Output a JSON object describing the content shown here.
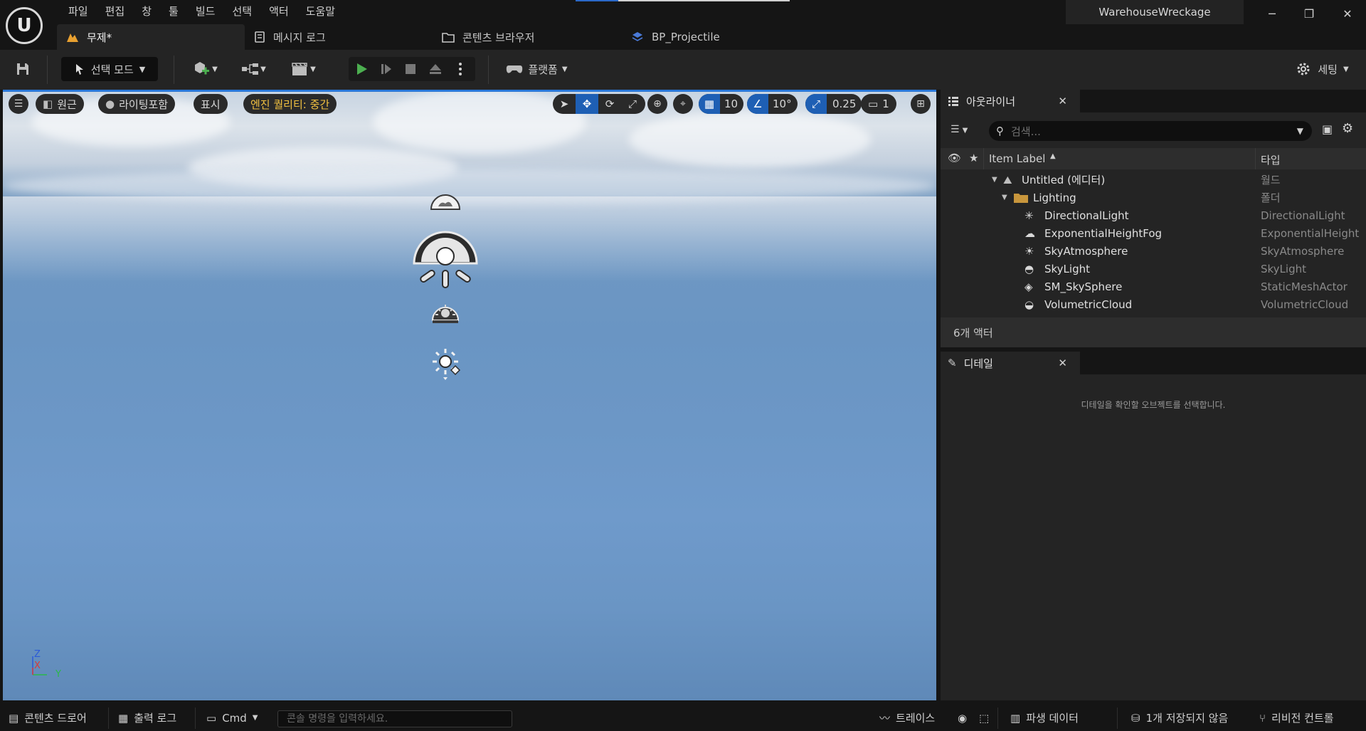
{
  "menu": [
    "파일",
    "편집",
    "창",
    "툴",
    "빌드",
    "선택",
    "액터",
    "도움말"
  ],
  "project_name": "WarehouseWreckage",
  "tabs": [
    {
      "label": "무제*",
      "active": true
    },
    {
      "label": "메시지 로그",
      "active": false
    },
    {
      "label": "콘텐츠 브라우저",
      "active": false
    },
    {
      "label": "BP_Projectile",
      "active": false
    }
  ],
  "toolbar": {
    "mode_label": "선택 모드",
    "platform_label": "플랫폼",
    "settings_label": "세팅"
  },
  "viewport": {
    "perspective_label": "원근",
    "lighting_label": "라이팅포함",
    "show_label": "표시",
    "quality_label": "엔진 퀄리티: 중간",
    "grid_snap": "10",
    "rotation_snap": "10°",
    "scale_snap": "0.25",
    "camera_speed": "1",
    "axis_z": "Z",
    "axis_x": "X",
    "axis_y": "Y"
  },
  "outliner": {
    "tab_label": "아웃라이너",
    "search_placeholder": "검색...",
    "col_label": "Item Label",
    "col_type": "타입",
    "rows": [
      {
        "label": "Untitled (에디터)",
        "type": "월드",
        "icon": "world-icon"
      },
      {
        "label": "Lighting",
        "type": "폴더",
        "icon": "folder-icon"
      },
      {
        "label": "DirectionalLight",
        "type": "DirectionalLight",
        "icon": "directional-light-icon"
      },
      {
        "label": "ExponentialHeightFog",
        "type": "ExponentialHeight",
        "icon": "fog-icon"
      },
      {
        "label": "SkyAtmosphere",
        "type": "SkyAtmosphere",
        "icon": "sky-atmosphere-icon"
      },
      {
        "label": "SkyLight",
        "type": "SkyLight",
        "icon": "sky-light-icon"
      },
      {
        "label": "SM_SkySphere",
        "type": "StaticMeshActor",
        "icon": "static-mesh-icon"
      },
      {
        "label": "VolumetricCloud",
        "type": "VolumetricCloud",
        "icon": "cloud-icon"
      }
    ],
    "actor_count": "6개 액터"
  },
  "details": {
    "tab_label": "디테일",
    "hint": "디테일을 확인할 오브젝트를 선택합니다."
  },
  "statusbar": {
    "content_drawer": "콘텐츠 드로어",
    "output_log": "출력 로그",
    "cmd_label": "Cmd",
    "cmd_placeholder": "콘솔 명령을 입력하세요.",
    "trace": "트레이스",
    "derived_data": "파생 데이터",
    "unsaved": "1개 저장되지 않음",
    "revision_control": "리비전 컨트롤"
  }
}
